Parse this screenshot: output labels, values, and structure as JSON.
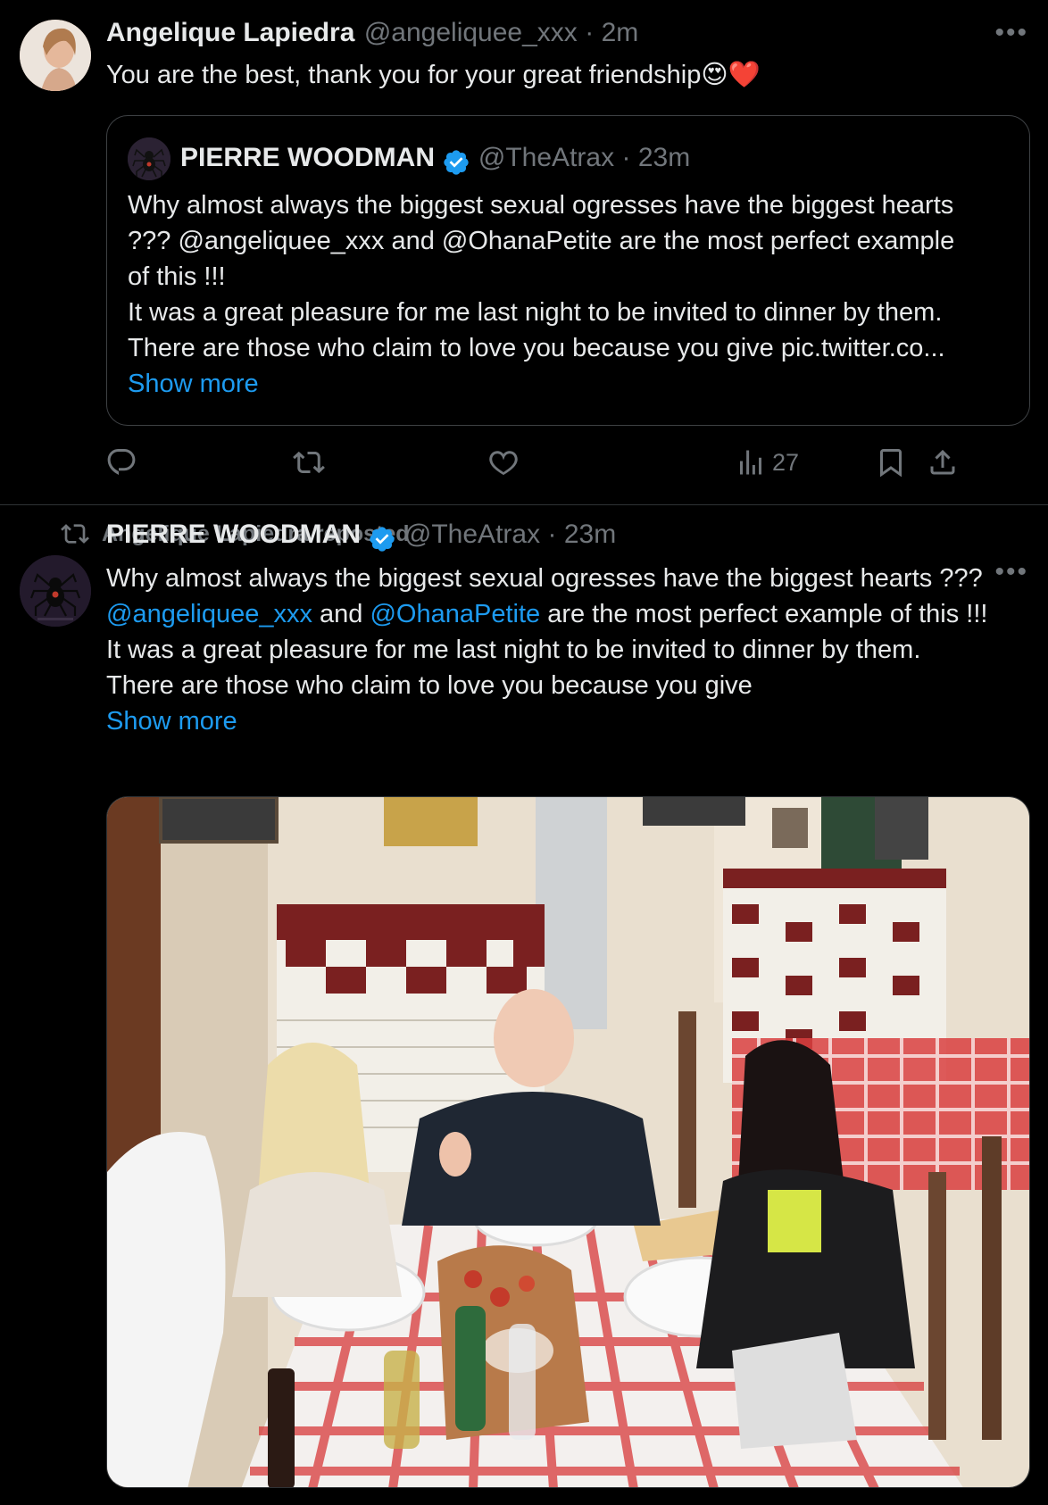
{
  "tweet1": {
    "author_name": "Angelique Lapiedra",
    "author_handle": "@angeliquee_xxx",
    "time": "· 2m",
    "text": "You are the best, thank you for your great friendship",
    "emoji": "😍❤️",
    "quote": {
      "author_name": "PIERRE WOODMAN",
      "author_handle": "@TheAtrax",
      "time": "· 23m",
      "lines": [
        "Why almost always the biggest sexual ogresses have the biggest hearts",
        "??? @angeliquee_xxx and @OhanaPetite are the most perfect example",
        "of this !!!",
        "It was a great pleasure for me last night to be invited to dinner by them.",
        "There are those who claim to love you because you give pic.twitter.co..."
      ],
      "show_more": "Show more"
    },
    "views": "27"
  },
  "tweet2": {
    "repost_label": "Angelique Lapiedra reposted",
    "author_name": "PIERRE WOODMAN",
    "author_handle": "@TheAtrax",
    "time": "· 23m",
    "line1": "Why almost always the biggest sexual ogresses have the biggest hearts ???",
    "mention1": "@angeliquee_xxx",
    "and": " and ",
    "mention2": "@OhanaPetite",
    "line2_rest": " are the most perfect example of this !!!",
    "line3": "It was a great pleasure for me last night to be invited to dinner by them.",
    "line4": "There are those who claim to love you because you give",
    "show_more": "Show more"
  },
  "icons": {
    "more": "more-dots-icon",
    "reply": "reply-icon",
    "repost": "repost-icon",
    "like": "heart-icon",
    "views": "views-icon",
    "bookmark": "bookmark-icon",
    "share": "share-icon",
    "verified": "verified-badge-icon"
  },
  "colors": {
    "background": "#000000",
    "text": "#e7e9ea",
    "secondary": "#71767b",
    "link": "#1d9bf0",
    "verified": "#1d9bf0"
  }
}
